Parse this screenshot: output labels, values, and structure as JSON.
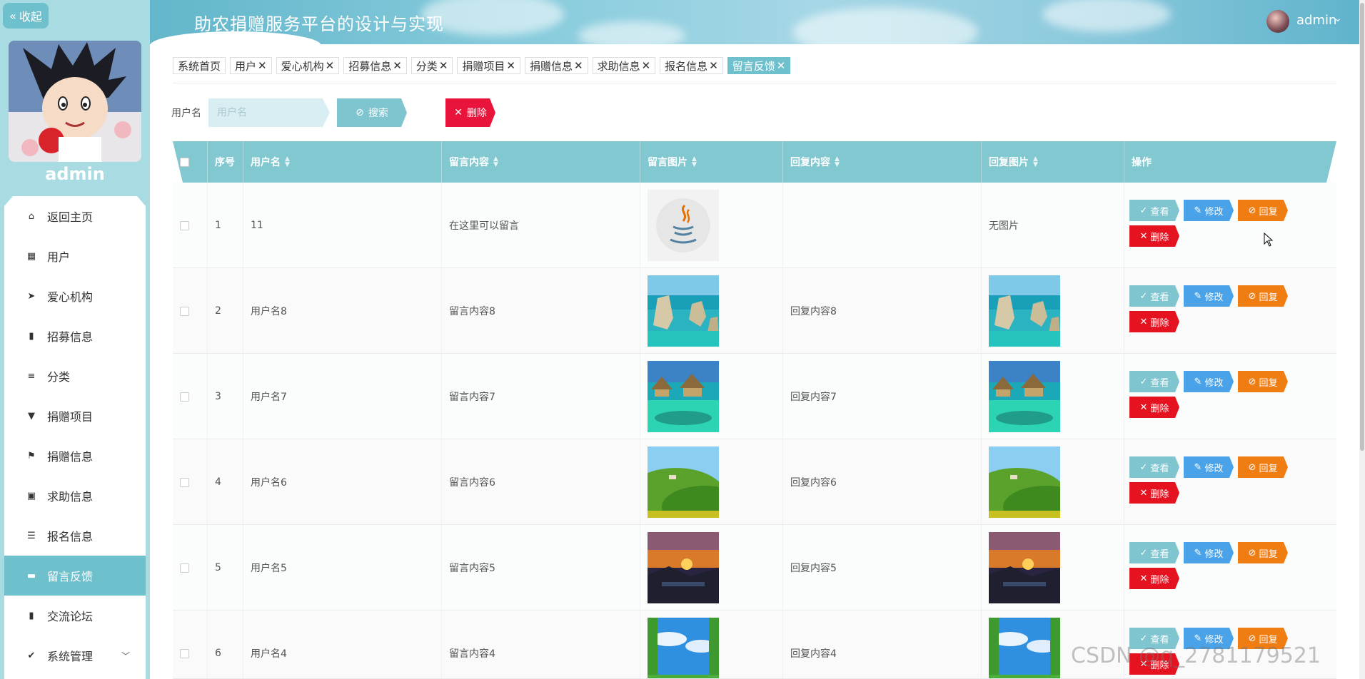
{
  "sidebar": {
    "collapse_label": "收起",
    "username": "admin",
    "menu": [
      {
        "label": "返回主页",
        "icon": "home-icon"
      },
      {
        "label": "用户",
        "icon": "grid-icon"
      },
      {
        "label": "爱心机构",
        "icon": "send-icon"
      },
      {
        "label": "招募信息",
        "icon": "book-icon"
      },
      {
        "label": "分类",
        "icon": "sliders-icon"
      },
      {
        "label": "捐赠项目",
        "icon": "bookmark-icon"
      },
      {
        "label": "捐赠信息",
        "icon": "flag-icon"
      },
      {
        "label": "求助信息",
        "icon": "clipboard-icon"
      },
      {
        "label": "报名信息",
        "icon": "list-icon"
      },
      {
        "label": "留言反馈",
        "icon": "message-icon"
      },
      {
        "label": "交流论坛",
        "icon": "bar-chart-icon"
      },
      {
        "label": "系统管理",
        "icon": "clipboard-check-icon"
      }
    ],
    "active_index": 9
  },
  "header": {
    "title": "助农捐赠服务平台的设计与实现",
    "user": "admin"
  },
  "tags": [
    {
      "label": "系统首页",
      "closable": false
    },
    {
      "label": "用户",
      "closable": true
    },
    {
      "label": "爱心机构",
      "closable": true
    },
    {
      "label": "招募信息",
      "closable": true
    },
    {
      "label": "分类",
      "closable": true
    },
    {
      "label": "捐赠项目",
      "closable": true
    },
    {
      "label": "捐赠信息",
      "closable": true
    },
    {
      "label": "求助信息",
      "closable": true
    },
    {
      "label": "报名信息",
      "closable": true
    },
    {
      "label": "留言反馈",
      "closable": true,
      "active": true
    }
  ],
  "search": {
    "label": "用户名",
    "placeholder": "用户名",
    "search_button": "搜索",
    "delete_button": "删除"
  },
  "table": {
    "columns": [
      "序号",
      "用户名",
      "留言内容",
      "留言图片",
      "回复内容",
      "回复图片",
      "操作"
    ],
    "no_image_text": "无图片",
    "actions": {
      "view": "查看",
      "edit": "修改",
      "reply": "回复",
      "delete": "删除"
    },
    "rows": [
      {
        "index": "1",
        "username": "11",
        "content": "在这里可以留言",
        "image": "java-logo",
        "reply": "",
        "reply_image": ""
      },
      {
        "index": "2",
        "username": "用户名8",
        "content": "留言内容8",
        "image": "sea-rocks",
        "reply": "回复内容8",
        "reply_image": "sea-rocks"
      },
      {
        "index": "3",
        "username": "用户名7",
        "content": "留言内容7",
        "image": "water-villas",
        "reply": "回复内容7",
        "reply_image": "water-villas"
      },
      {
        "index": "4",
        "username": "用户名6",
        "content": "留言内容6",
        "image": "green-hills",
        "reply": "回复内容6",
        "reply_image": "green-hills"
      },
      {
        "index": "5",
        "username": "用户名5",
        "content": "留言内容5",
        "image": "sunset",
        "reply": "回复内容5",
        "reply_image": "sunset"
      },
      {
        "index": "6",
        "username": "用户名4",
        "content": "留言内容4",
        "image": "sky-meadow",
        "reply": "回复内容4",
        "reply_image": "sky-meadow"
      }
    ]
  },
  "watermark": "CSDN @q_2781179521"
}
